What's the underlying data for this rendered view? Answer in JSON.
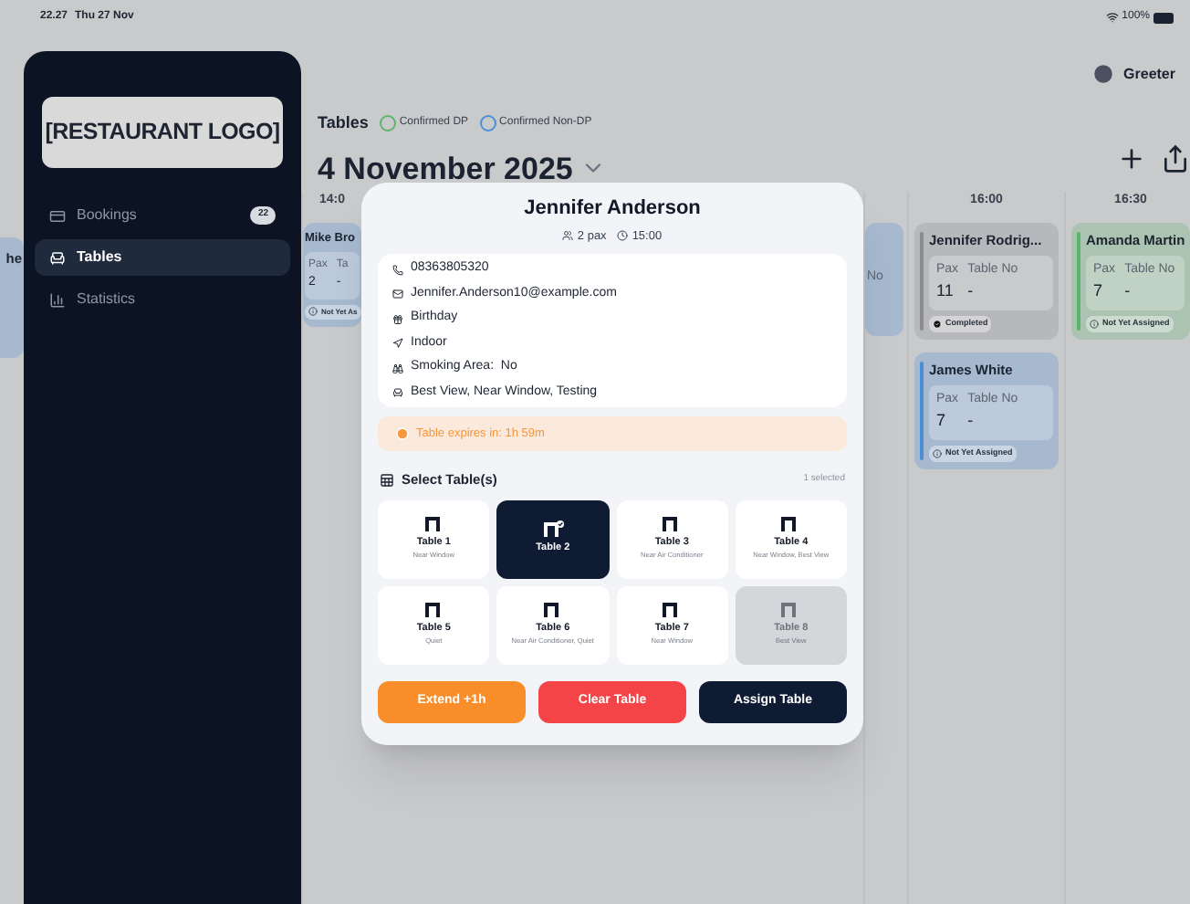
{
  "status_bar": {
    "time": "22.27",
    "date": "Thu 27 Nov",
    "battery": "100%"
  },
  "sidebar": {
    "logo": "[RESTAURANT LOGO]",
    "items": [
      {
        "kind": "bookings",
        "label": "Bookings",
        "badge": "22",
        "selected": false
      },
      {
        "kind": "tables",
        "label": "Tables",
        "selected": true
      },
      {
        "kind": "statistics",
        "label": "Statistics",
        "selected": false
      }
    ]
  },
  "user": "Greeter",
  "header": {
    "title": "Tables",
    "legend": [
      {
        "label": "Confirmed DP",
        "color": "#5fb36a"
      },
      {
        "label": "Confirmed Non-DP",
        "color": "#4a8fd6"
      }
    ],
    "date": "4 November 2025"
  },
  "edge_card": {
    "name": "he"
  },
  "columns": [
    {
      "time": "14:0",
      "kind": "narrow",
      "cards": [
        {
          "name": "Mike Bro",
          "pax_label": "Pax",
          "table_label": "Ta",
          "pax": "2",
          "table_no": "-",
          "status": "Not Yet As",
          "kind": "not_assigned"
        }
      ]
    },
    {
      "kind": "sliver",
      "cards": [
        {
          "table_label": "No"
        }
      ]
    },
    {
      "time": "16:00",
      "kind": "full",
      "cards": [
        {
          "name": "Jennifer Rodrig...",
          "color": "#8a8b8e",
          "pax_label": "Pax",
          "table_label": "Table No",
          "pax": "11",
          "table_no": "-",
          "status": "Completed",
          "kind": "completed"
        },
        {
          "name": "James White",
          "color": "#4a8fd6",
          "pax_label": "Pax",
          "table_label": "Table No",
          "pax": "7",
          "table_no": "-",
          "status": "Not Yet Assigned",
          "kind": "not_assigned"
        }
      ]
    },
    {
      "time": "16:30",
      "kind": "edge",
      "cards": [
        {
          "name": "Amanda Martin",
          "color": "#5fb36a",
          "pax_label": "Pax",
          "table_label": "Table No",
          "pax": "7",
          "table_no": "-",
          "status": "Not Yet Assigned",
          "kind": "not_assigned"
        }
      ]
    }
  ],
  "modal": {
    "name": "Jennifer Anderson",
    "pax": "2 pax",
    "time": "15:00",
    "details": [
      {
        "kind": "phone",
        "text": "08363805320"
      },
      {
        "kind": "email",
        "text": "Jennifer.Anderson10@example.com"
      },
      {
        "kind": "occasion",
        "text": "Birthday"
      },
      {
        "kind": "location",
        "text": "Indoor"
      },
      {
        "kind": "smoking",
        "text": "Smoking Area:  No"
      },
      {
        "kind": "preference",
        "text": "Best View, Near Window, Testing"
      }
    ],
    "expiry": "Table expires in: 1h 59m",
    "select_title": "Select Table(s)",
    "selected_count": "1 selected",
    "tables": [
      {
        "name": "Table 1",
        "note": "Near Window",
        "selected": false,
        "disabled": false
      },
      {
        "name": "Table 2",
        "selected": true,
        "disabled": false
      },
      {
        "name": "Table 3",
        "note": "Near Air Conditioner",
        "selected": false,
        "disabled": false
      },
      {
        "name": "Table 4",
        "note": "Near Window, Best View",
        "selected": false,
        "disabled": false
      },
      {
        "name": "Table 5",
        "note": "Quiet",
        "selected": false,
        "disabled": false
      },
      {
        "name": "Table 6",
        "note": "Near Air Conditioner, Quiet",
        "selected": false,
        "disabled": false
      },
      {
        "name": "Table 7",
        "note": "Near Window",
        "selected": false,
        "disabled": false
      },
      {
        "name": "Table 8",
        "note": "Best View",
        "selected": false,
        "disabled": true
      }
    ],
    "buttons": [
      {
        "kind": "extend",
        "label": "Extend +1h"
      },
      {
        "kind": "clear",
        "label": "Clear Table"
      },
      {
        "kind": "assign",
        "label": "Assign Table"
      }
    ]
  }
}
